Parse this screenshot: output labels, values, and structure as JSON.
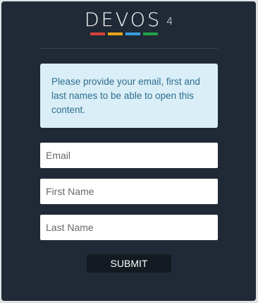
{
  "logo": {
    "text": "DEVOS",
    "version": "4",
    "bar_colors": [
      "#d8413a",
      "#e9a319",
      "#3b9edb",
      "#21a14a"
    ]
  },
  "notice": {
    "message": "Please provide your email, first and last names to be able to open this content."
  },
  "form": {
    "email_placeholder": "Email",
    "first_name_placeholder": "First Name",
    "last_name_placeholder": "Last Name",
    "submit_label": "SUBMIT"
  }
}
